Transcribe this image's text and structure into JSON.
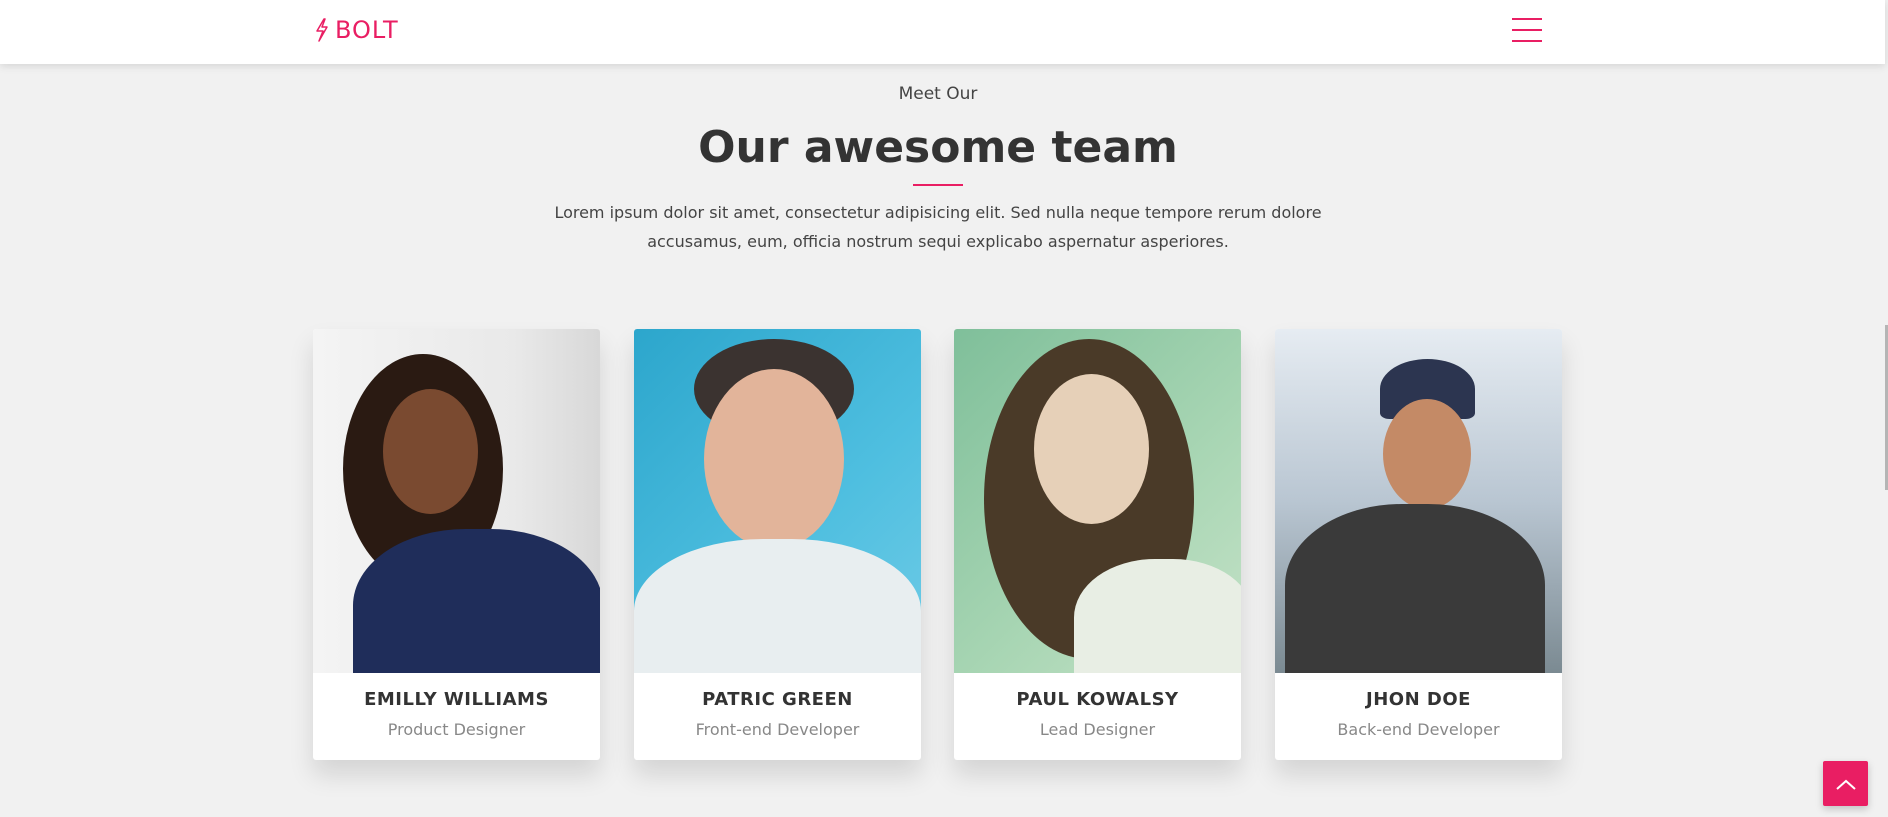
{
  "header": {
    "brand": "BOLT",
    "brand_color": "#e91e63",
    "logo_icon": "lightning-bolt-icon",
    "menu_icon": "hamburger-menu-icon"
  },
  "team": {
    "eyebrow": "Meet Our",
    "title": "Our awesome team",
    "description": "Lorem ipsum dolor sit amet, consectetur adipisicing elit. Sed nulla neque tempore rerum dolore accusamus, eum, officia nostrum sequi explicabo aspernatur asperiores.",
    "members": [
      {
        "name": "EMILLY WILLIAMS",
        "role": "Product Designer"
      },
      {
        "name": "PATRIC GREEN",
        "role": "Front-end Developer"
      },
      {
        "name": "PAUL KOWALSY",
        "role": "Lead Designer"
      },
      {
        "name": "JHON DOE",
        "role": "Back-end Developer"
      }
    ]
  },
  "back_to_top": {
    "icon": "chevron-up-icon"
  }
}
